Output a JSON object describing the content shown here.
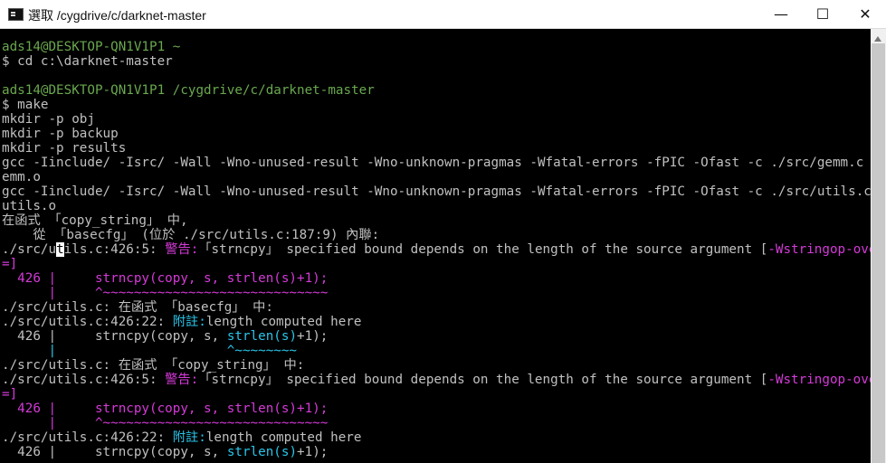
{
  "window": {
    "title": "選取 /cygdrive/c/darknet-master",
    "minimize": "—",
    "maximize": "☐",
    "close": "✕"
  },
  "terminal": {
    "prompt1": "ads14@DESKTOP-QN1V1P1 ~",
    "cmd1": "$ cd c:\\darknet-master",
    "prompt2": "ads14@DESKTOP-QN1V1P1 /cygdrive/c/darknet-master",
    "cmd2": "$ make",
    "out1": "mkdir -p obj",
    "out2": "mkdir -p backup",
    "out3": "mkdir -p results",
    "gcc1": "gcc -Iinclude/ -Isrc/ -Wall -Wno-unused-result -Wno-unknown-pragmas -Wfatal-errors -fPIC -Ofast -c ./src/gemm.c -o obj/g",
    "gcc1b": "emm.o",
    "gcc2": "gcc -Iinclude/ -Isrc/ -Wall -Wno-unused-result -Wno-unknown-pragmas -Wfatal-errors -fPIC -Ofast -c ./src/utils.c -o obj/",
    "gcc2b": "utils.o",
    "func1": "在函式 「copy_string」 中,",
    "inline1": "    從 「basecfg」 (位於 ./src/utils.c:187:9) 內聯:",
    "warn1a": "./src/u",
    "warn1cursor": "t",
    "warn1b": "ils.c:426:5: ",
    "warnLabel": "警告:",
    "warnText": "「strncpy」 specified bound depends on the length of the source argument [",
    "warnFlag": "-Wstringop-overflow",
    "warnEnd": "=]",
    "code1": "  426 |     strncpy(copy, s, strlen(s)+1);",
    "caret1": "      |     ^~~~~~~~~~~~~~~~~~~~~~~~~~~~~~",
    "func2": "./src/utils.c: 在函式 「basecfg」 中:",
    "note1a": "./src/utils.c:426:22: ",
    "noteLabel": "附註:",
    "noteText": "length computed here",
    "code2a": "  426 |     strncpy(copy, s, ",
    "strlen": "strlen(s)",
    "code2b": "+1);",
    "caret2": "      |                      ^~~~~~~~~",
    "func3": "./src/utils.c: 在函式 「copy_string」 中:",
    "warn2a": "./src/utils.c:426:5: ",
    "code3": "  426 |     strncpy(copy, s, strlen(s)+1);",
    "caret3": "      |     ^~~~~~~~~~~~~~~~~~~~~~~~~~~~~~",
    "note2a": "./src/utils.c:426:22: ",
    "code4a": "  426 |     strncpy(copy, s, ",
    "code4b": "+1);"
  }
}
